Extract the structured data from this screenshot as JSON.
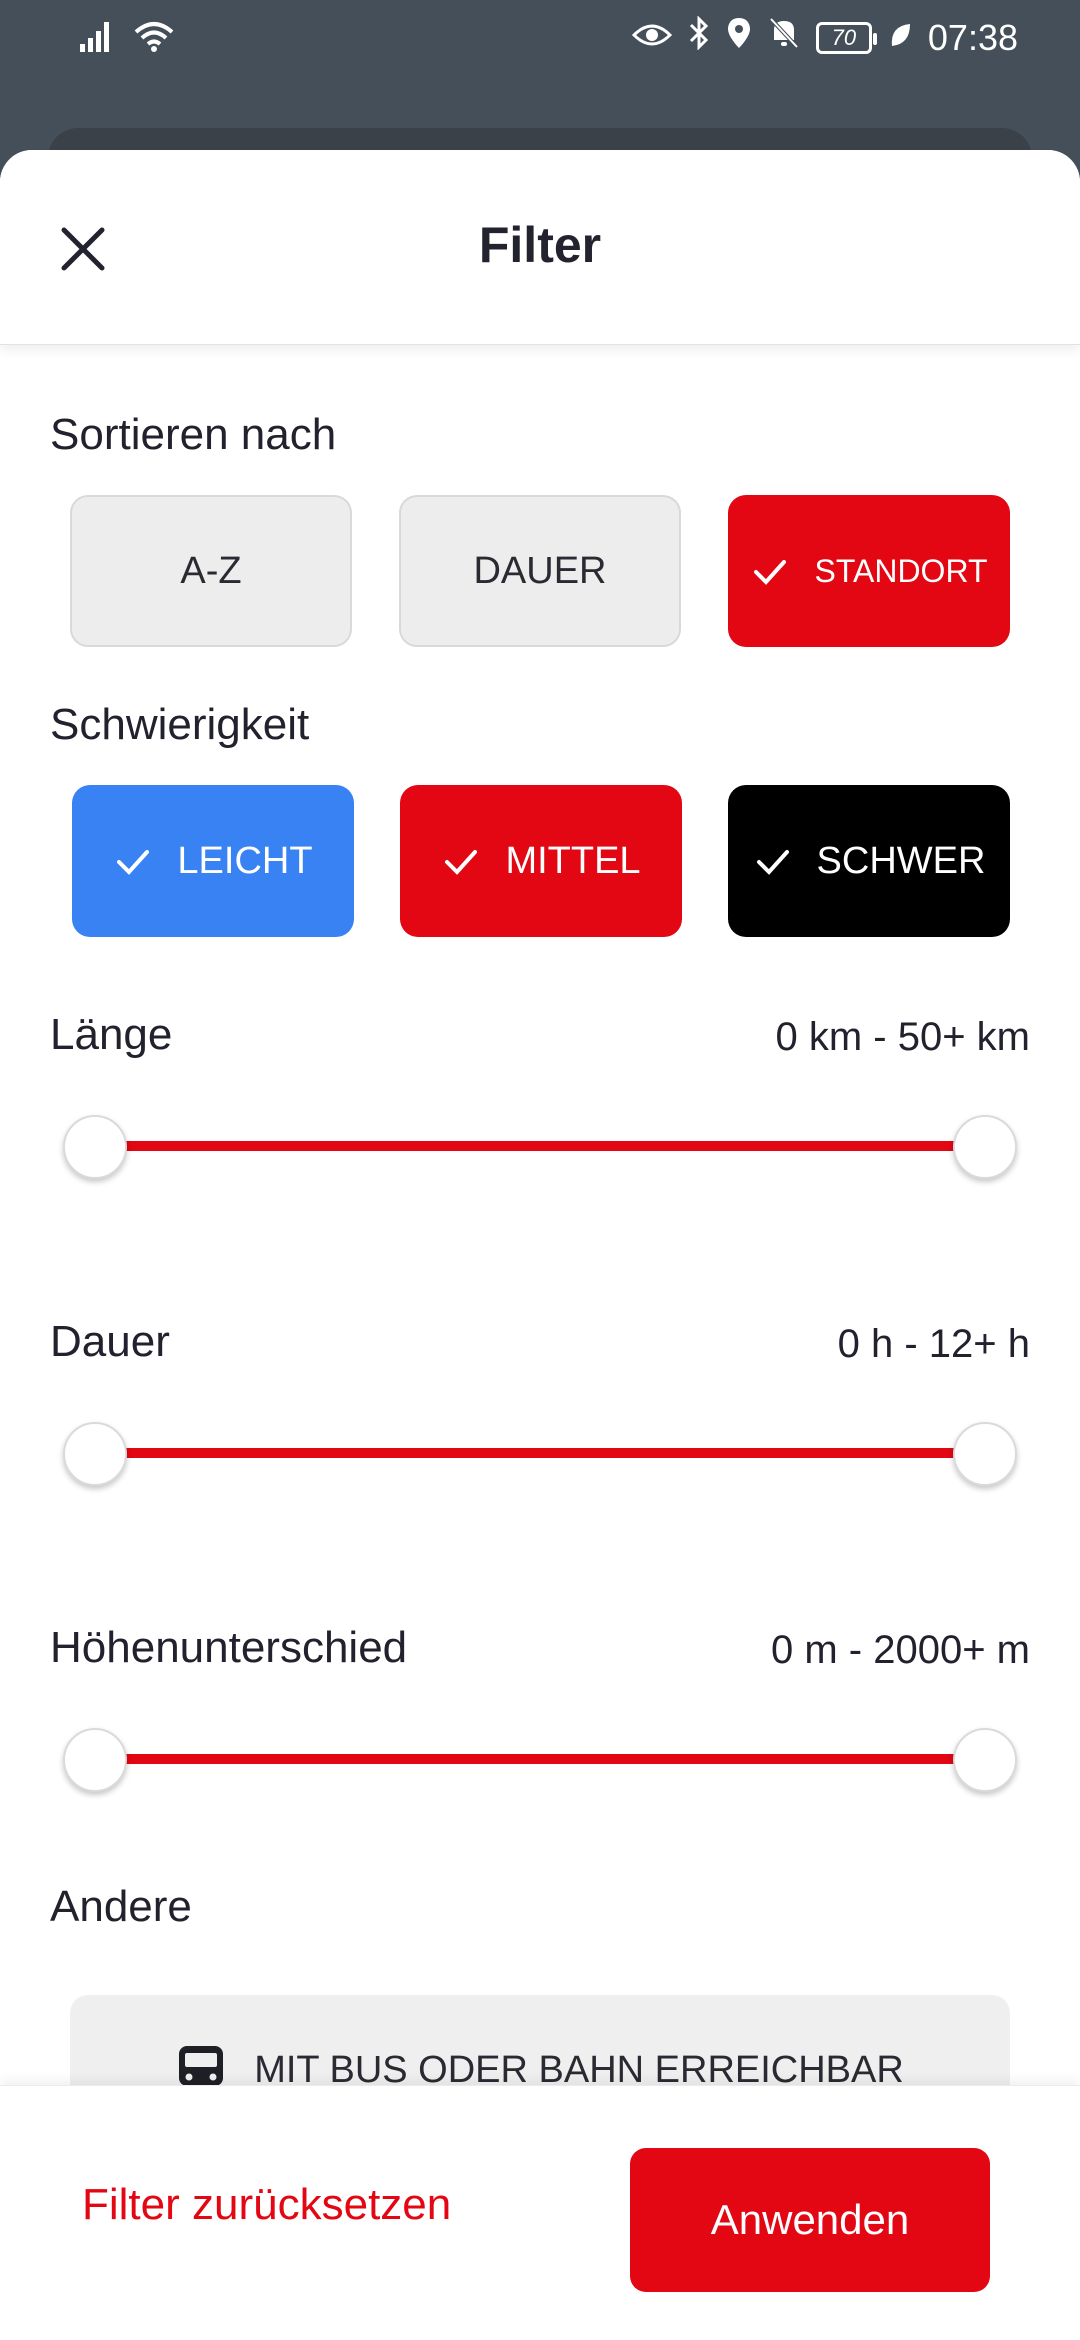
{
  "status_bar": {
    "time": "07:38",
    "battery": "70",
    "icons": [
      "signal-icon",
      "wifi-icon",
      "eye-icon",
      "bluetooth-icon",
      "location-icon",
      "mute-icon",
      "battery-icon",
      "leaf-icon"
    ]
  },
  "header": {
    "title": "Filter"
  },
  "sort": {
    "label": "Sortieren nach",
    "options": [
      {
        "label": "A-Z",
        "selected": false
      },
      {
        "label": "DAUER",
        "selected": false
      },
      {
        "label": "STANDORT",
        "selected": true
      }
    ]
  },
  "difficulty": {
    "label": "Schwierigkeit",
    "options": [
      {
        "label": "LEICHT",
        "selected": true,
        "color": "#3882f4"
      },
      {
        "label": "MITTEL",
        "selected": true,
        "color": "#e30613"
      },
      {
        "label": "SCHWER",
        "selected": true,
        "color": "#000000"
      }
    ]
  },
  "length": {
    "label": "Länge",
    "range": "0 km - 50+ km",
    "min_fraction": 0,
    "max_fraction": 1
  },
  "duration": {
    "label": "Dauer",
    "range": "0 h - 12+ h",
    "min_fraction": 0,
    "max_fraction": 1
  },
  "elevation": {
    "label": "Höhenunterschied",
    "range": "0 m - 2000+ m",
    "min_fraction": 0,
    "max_fraction": 1
  },
  "other": {
    "label": "Andere",
    "transit_option": "MIT BUS ODER BAHN ERREICHBAR"
  },
  "footer": {
    "reset_label": "Filter zurücksetzen",
    "apply_label": "Anwenden"
  },
  "colors": {
    "accent": "#e30613",
    "easy": "#3882f4",
    "hard": "#000000"
  }
}
